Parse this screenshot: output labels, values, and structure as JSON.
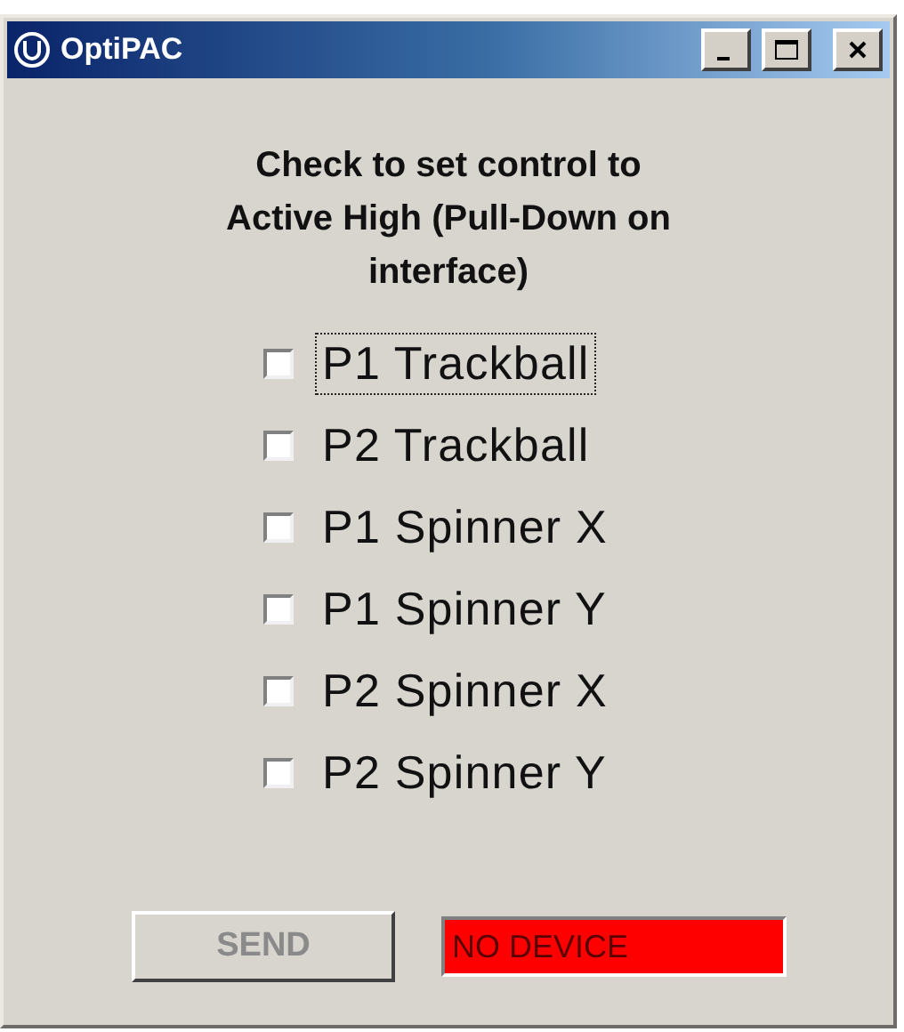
{
  "window": {
    "title": "OptiPAC"
  },
  "instruction": "Check to set control to Active High (Pull-Down on interface)",
  "controls": [
    {
      "label": "P1 Trackball",
      "checked": false,
      "focused": true
    },
    {
      "label": "P2 Trackball",
      "checked": false,
      "focused": false
    },
    {
      "label": "P1 Spinner X",
      "checked": false,
      "focused": false
    },
    {
      "label": "P1 Spinner Y",
      "checked": false,
      "focused": false
    },
    {
      "label": "P2 Spinner X",
      "checked": false,
      "focused": false
    },
    {
      "label": "P2 Spinner Y",
      "checked": false,
      "focused": false
    }
  ],
  "send_button": {
    "label": "SEND",
    "disabled": true
  },
  "status": {
    "text": "NO DEVICE",
    "color": "#ff0000"
  }
}
